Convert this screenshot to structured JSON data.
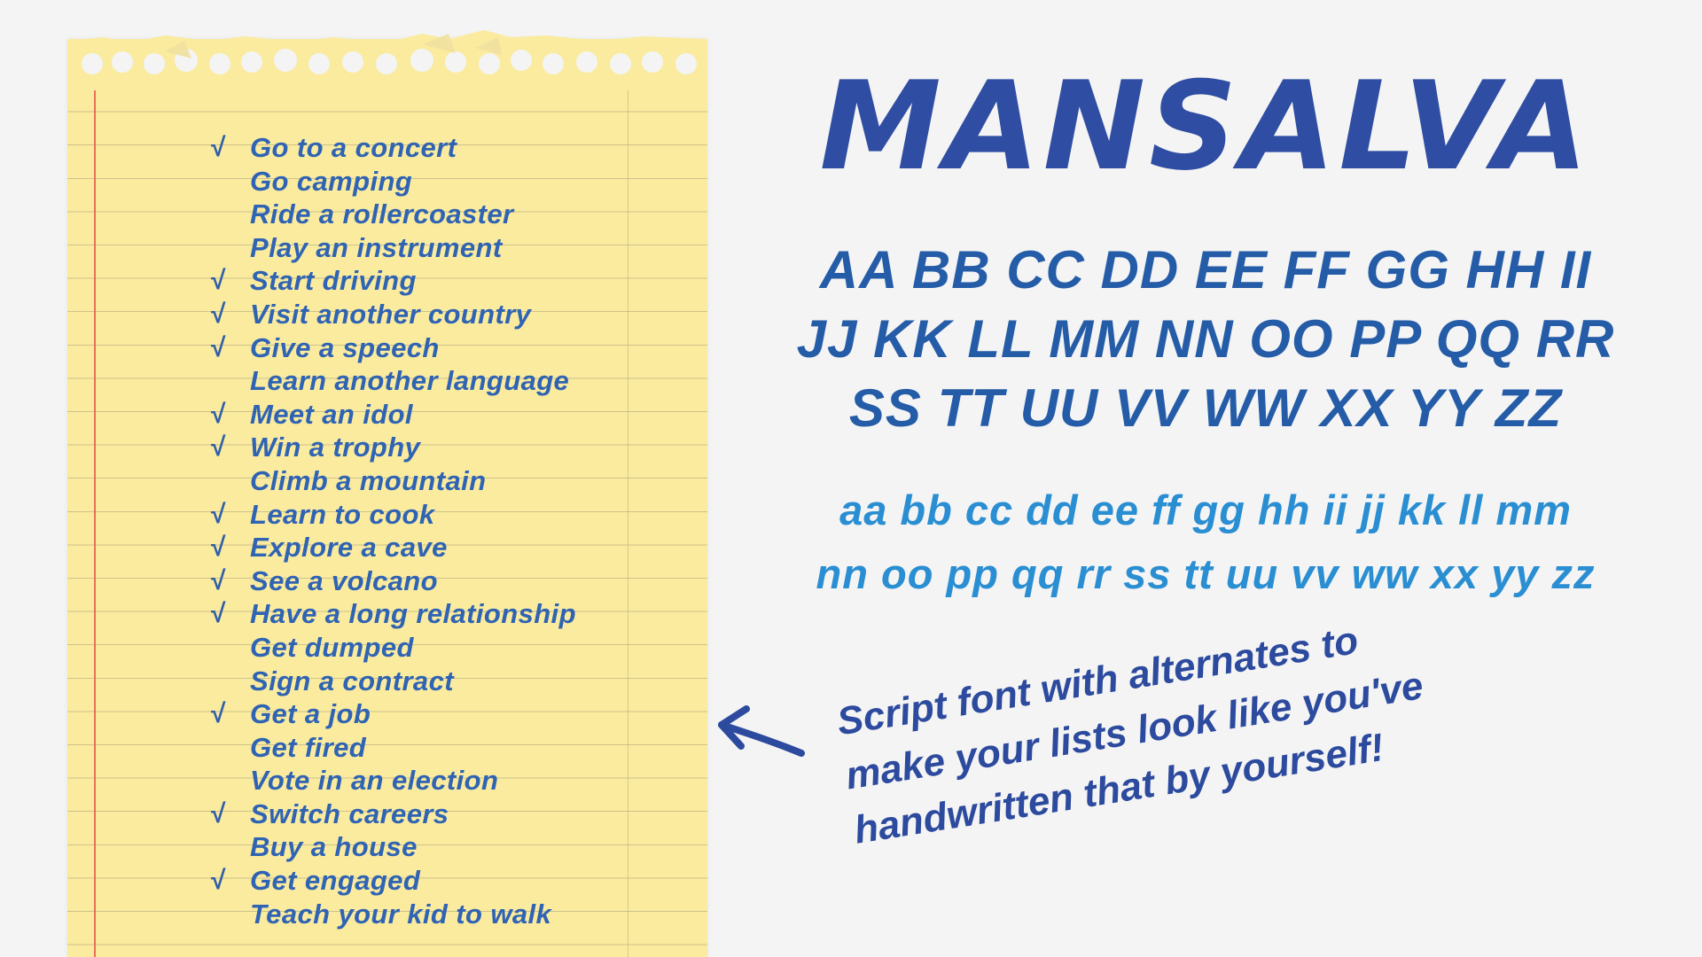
{
  "title": "MANSALVA",
  "uppercase_rows": [
    "AA BB CC DD EE FF GG HH II",
    "JJ KK LL MM NN OO PP QQ RR",
    "SS TT UU VV WW XX YY ZZ"
  ],
  "lowercase_rows": [
    "aa bb cc dd ee ff gg hh ii jj kk ll mm",
    "nn oo pp qq rr ss tt uu vv ww xx yy zz"
  ],
  "check_symbol": "√",
  "todo_items": [
    {
      "text": "Go to a concert",
      "checked": true
    },
    {
      "text": "Go camping",
      "checked": false
    },
    {
      "text": "Ride a rollercoaster",
      "checked": false
    },
    {
      "text": "Play an instrument",
      "checked": false
    },
    {
      "text": "Start driving",
      "checked": true
    },
    {
      "text": "Visit another country",
      "checked": true
    },
    {
      "text": "Give a speech",
      "checked": true
    },
    {
      "text": "Learn another language",
      "checked": false
    },
    {
      "text": "Meet an idol",
      "checked": true
    },
    {
      "text": "Win a trophy",
      "checked": true
    },
    {
      "text": "Climb a mountain",
      "checked": false
    },
    {
      "text": "Learn to cook",
      "checked": true
    },
    {
      "text": "Explore a cave",
      "checked": true
    },
    {
      "text": "See a volcano",
      "checked": true
    },
    {
      "text": "Have a long relationship",
      "checked": true
    },
    {
      "text": "Get dumped",
      "checked": false
    },
    {
      "text": "Sign a contract",
      "checked": false
    },
    {
      "text": "Get a job",
      "checked": true
    },
    {
      "text": "Get fired",
      "checked": false
    },
    {
      "text": "Vote in an election",
      "checked": false
    },
    {
      "text": "Switch careers",
      "checked": true
    },
    {
      "text": "Buy a house",
      "checked": false
    },
    {
      "text": "Get engaged",
      "checked": true
    },
    {
      "text": "Teach your kid to walk",
      "checked": false
    }
  ],
  "caption_lines": [
    "Script font with alternates to",
    "make your lists look like you've",
    "handwritten that by yourself!"
  ],
  "colors": {
    "paper": "#faeb9f",
    "ink_dark": "#2f4da2",
    "ink_list": "#2f63b3",
    "ink_light": "#2a8ed2",
    "margin_line": "#e45c4c"
  }
}
